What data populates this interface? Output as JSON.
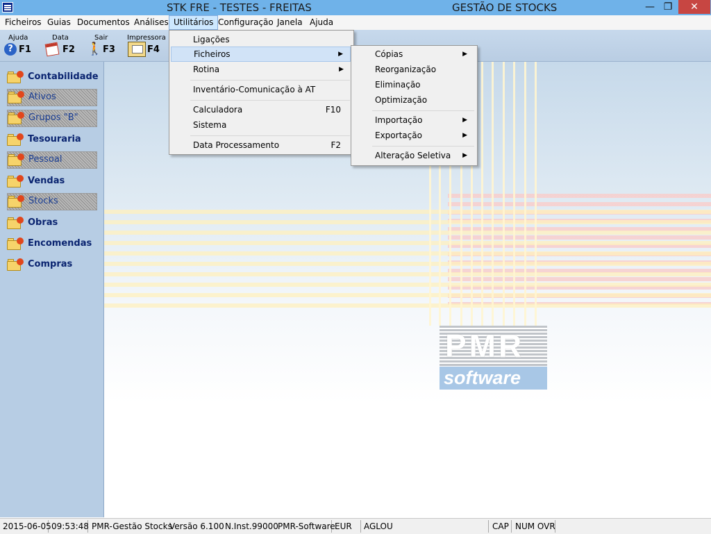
{
  "window": {
    "title": "STK FRE - TESTES - FREITAS",
    "app_title": "GESTÃO DE STOCKS",
    "min_glyph": "—",
    "max_glyph": "❐",
    "close_glyph": "✕"
  },
  "menubar": {
    "items": [
      "Ficheiros",
      "Guias",
      "Documentos",
      "Análises",
      "Utilitários",
      "Configuração",
      "Janela",
      "Ajuda"
    ],
    "active": "Utilitários"
  },
  "toolbar": {
    "help": {
      "label": "Ajuda",
      "key": "F1",
      "glyph": "?"
    },
    "date": {
      "label": "Data",
      "key": "F2"
    },
    "exit": {
      "label": "Sair",
      "key": "F3",
      "glyph": "🚶"
    },
    "printer": {
      "label": "Impressora",
      "key": "F4"
    }
  },
  "sidebar": {
    "items": [
      {
        "label": "Contabilidade",
        "type": "main"
      },
      {
        "label": "Ativos",
        "type": "sub"
      },
      {
        "label": "Grupos \"B\"",
        "type": "sub"
      },
      {
        "label": "Tesouraria",
        "type": "main"
      },
      {
        "label": "Pessoal",
        "type": "sub"
      },
      {
        "label": "Vendas",
        "type": "main"
      },
      {
        "label": "Stocks",
        "type": "sub"
      },
      {
        "label": "Obras",
        "type": "main"
      },
      {
        "label": "Encomendas",
        "type": "main"
      },
      {
        "label": "Compras",
        "type": "main"
      }
    ]
  },
  "utilitarios_menu": {
    "items": [
      {
        "label": "Ligações",
        "shortcut": ""
      },
      {
        "label": "Ficheiros",
        "shortcut": "",
        "submenu": true,
        "highlighted": true
      },
      {
        "label": "Rotina",
        "shortcut": "",
        "submenu": true
      },
      {
        "label": "Inventário-Comunicação à AT",
        "shortcut": ""
      },
      {
        "label": "Calculadora",
        "shortcut": "F10"
      },
      {
        "label": "Sistema",
        "shortcut": ""
      },
      {
        "label": "Data Processamento",
        "shortcut": "F2"
      }
    ]
  },
  "ficheiros_submenu": {
    "items": [
      {
        "label": "Cópias",
        "submenu": true
      },
      {
        "label": "Reorganização"
      },
      {
        "label": "Eliminação"
      },
      {
        "label": "Optimização"
      },
      {
        "label": "Importação",
        "submenu": true
      },
      {
        "label": "Exportação",
        "submenu": true
      },
      {
        "label": "Alteração Seletiva",
        "submenu": true
      }
    ]
  },
  "logo": {
    "top": "PMR",
    "bottom": "software"
  },
  "statusbar": {
    "date": "2015-06-05",
    "time": "09:53:48",
    "app": "PMR-Gestão Stocks",
    "version": "Versão  6.100",
    "inst": "N.Inst.99000",
    "vendor": "PMR-Software",
    "currency": "EUR",
    "user": "AGLOU",
    "cap": "CAP",
    "num_ovr": "NUM OVR"
  },
  "colors": {
    "titlebar": "#6fb2e9",
    "close": "#c74642",
    "sidebar": "#b7cde4",
    "menu_highlight": "#d1e3f7"
  }
}
